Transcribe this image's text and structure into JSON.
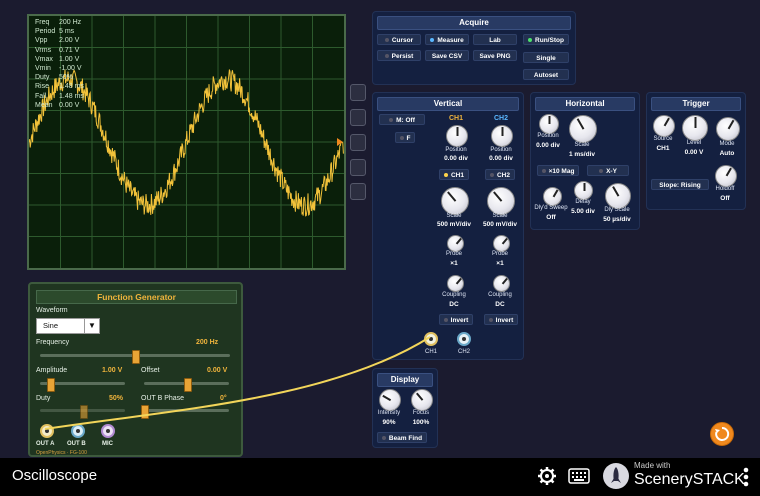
{
  "readout": [
    {
      "k": "Freq",
      "v": "200 Hz"
    },
    {
      "k": "Period",
      "v": "5 ms"
    },
    {
      "k": "Vpp",
      "v": "2.00 V"
    },
    {
      "k": "Vrms",
      "v": "0.71 V"
    },
    {
      "k": "Vmax",
      "v": "1.00 V"
    },
    {
      "k": "Vmin",
      "v": "-1.00 V"
    },
    {
      "k": "Duty",
      "v": "50%"
    },
    {
      "k": "Rise",
      "v": "1.48 ms"
    },
    {
      "k": "Fall",
      "v": "1.48 ms"
    },
    {
      "k": "Mean",
      "v": "0.00 V"
    }
  ],
  "acquire": {
    "title": "Acquire",
    "cursor": "Cursor",
    "measure": "Measure",
    "lab": "Lab",
    "run_stop": "Run/Stop",
    "persist": "Persist",
    "save_csv": "Save CSV",
    "save_png": "Save PNG",
    "single": "Single",
    "autoset": "Autoset"
  },
  "vertical": {
    "title": "Vertical",
    "math_label": "M: Off",
    "f_label": "F",
    "ch1": {
      "name": "CH1",
      "position_label": "Position",
      "position": "0.00 div",
      "button": "CH1",
      "scale_label": "Scale",
      "scale": "500 mV/div",
      "probe_label": "Probe",
      "probe": "×1",
      "coupling_label": "Coupling",
      "coupling": "DC",
      "invert": "Invert",
      "jack": "CH1"
    },
    "ch2": {
      "name": "CH2",
      "position_label": "Position",
      "position": "0.00 div",
      "button": "CH2",
      "scale_label": "Scale",
      "scale": "500 mV/div",
      "probe_label": "Probe",
      "probe": "×1",
      "coupling_label": "Coupling",
      "coupling": "DC",
      "invert": "Invert",
      "jack": "CH2"
    }
  },
  "horizontal": {
    "title": "Horizontal",
    "position_label": "Position",
    "position": "0.00 div",
    "scale_label": "Scale",
    "scale": "1 ms/div",
    "mag": "×10 Mag",
    "xy": "X-Y",
    "dlyd_sweep_label": "Dly'd Sweep",
    "dlyd_sweep": "Off",
    "delay_label": "Delay",
    "delay": "5.00 div",
    "dly_scale_label": "Dly Scale",
    "dly_scale": "50 µs/div"
  },
  "trigger": {
    "title": "Trigger",
    "source_label": "Source",
    "source": "CH1",
    "level_label": "Level",
    "level": "0.00 V",
    "mode_label": "Mode",
    "mode": "Auto",
    "slope": "Slope: Rising",
    "holdoff_label": "Holdoff",
    "holdoff": "Off"
  },
  "display": {
    "title": "Display",
    "intensity_label": "Intensity",
    "intensity": "90%",
    "focus_label": "Focus",
    "focus": "100%",
    "beam_find": "Beam Find"
  },
  "function_generator": {
    "title": "Function Generator",
    "waveform_label": "Waveform",
    "waveform": "Sine",
    "frequency_label": "Frequency",
    "frequency": "200 Hz",
    "frequency_fraction": 0.5,
    "amplitude_label": "Amplitude",
    "amplitude": "1.00 V",
    "amplitude_fraction": 0.12,
    "offset_label": "Offset",
    "offset": "0.00 V",
    "offset_fraction": 0.5,
    "duty_label": "Duty",
    "duty": "50%",
    "duty_fraction": 0.5,
    "outb_phase_label": "OUT B Phase",
    "outb_phase": "0°",
    "outb_phase_fraction": 0.0,
    "out_a": "OUT A",
    "out_b": "OUT B",
    "mic": "MIC",
    "brand": "OpenPhysics · FG-100"
  },
  "nav": {
    "title": "Oscilloscope",
    "made_with": "Made with",
    "brand": "ScenerySTACK"
  },
  "colors": {
    "trace": "#f2c23a",
    "grid": "#2d5a2d",
    "accent": "#f0b43c",
    "ch2": "#5ab7ff"
  },
  "icons": [
    "gear-icon",
    "keyboard-icon",
    "rocket-icon",
    "kebab-menu-icon",
    "reset-all-icon"
  ]
}
